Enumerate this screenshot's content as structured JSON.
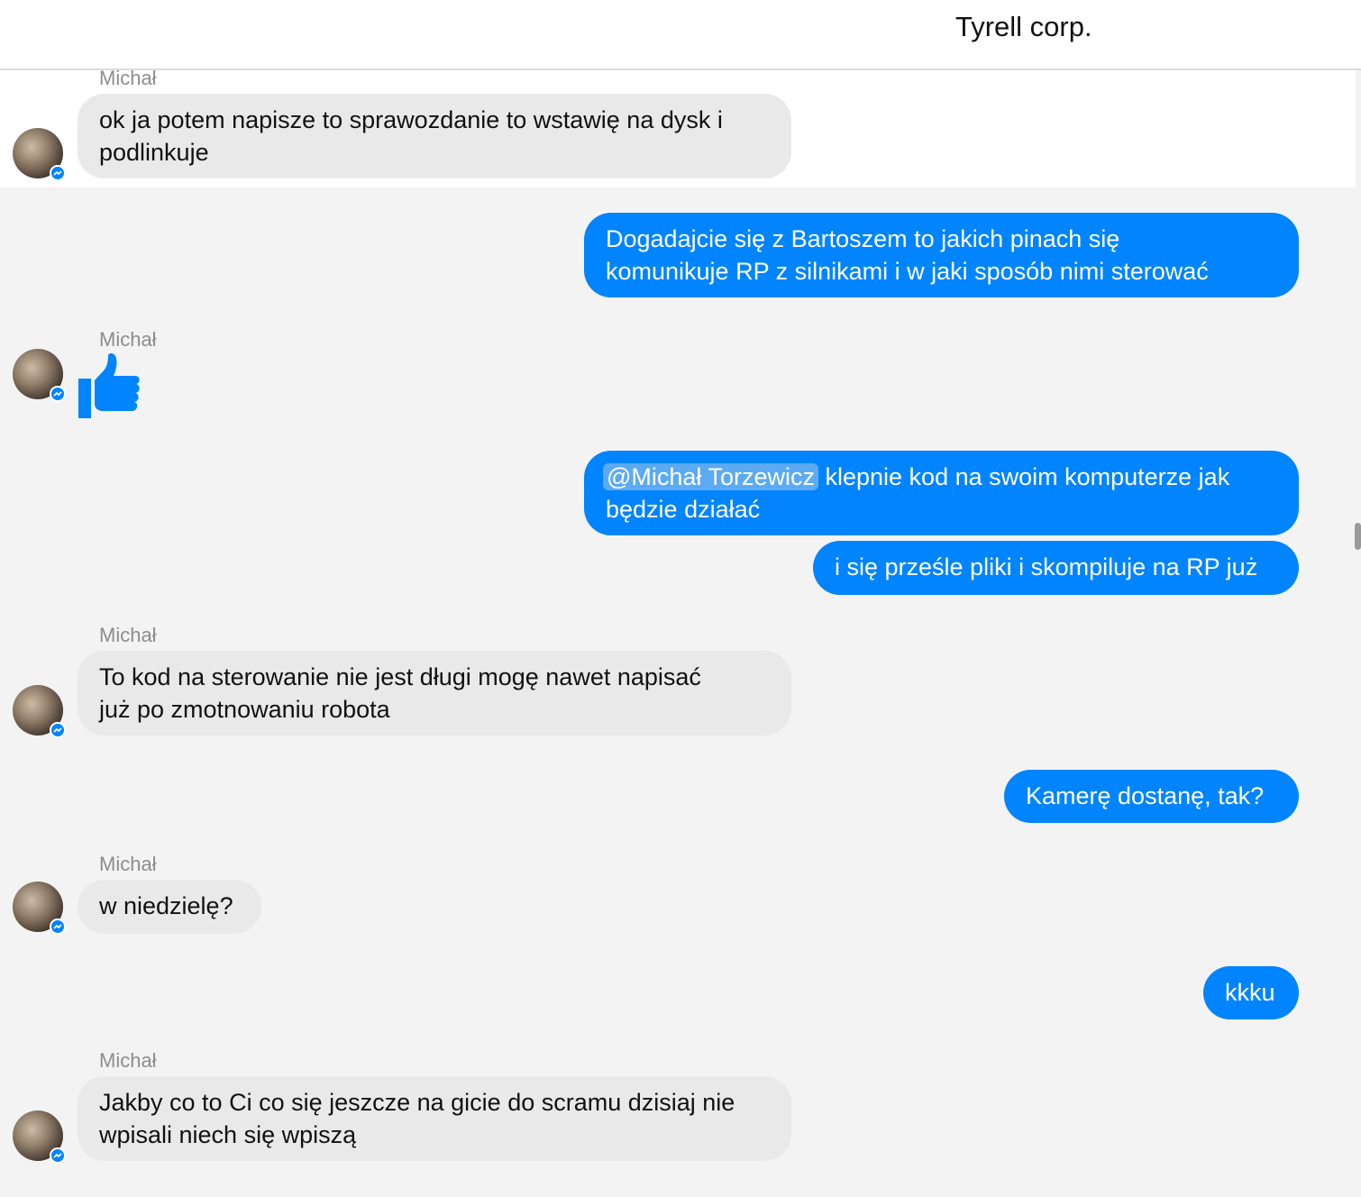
{
  "header": {
    "title": "Tyrell corp."
  },
  "messages": [
    {
      "sender": "Michał",
      "lines": [
        "ok ja potem napisze to sprawozdanie to wstawię na dysk i",
        "podlinkuje"
      ]
    },
    {
      "lines": [
        "Dogadajcie się z Bartoszem to jakich pinach się",
        "komunikuje RP z silnikami i w jaki sposób nimi sterować"
      ]
    },
    {
      "sender": "Michał",
      "sticker": "thumbs-up-icon"
    },
    {
      "mention": "@Michał Torzewicz",
      "lines": [
        "klepnie kod na swoim komputerze jak",
        "będzie działać"
      ]
    },
    {
      "lines": [
        "i się prześle pliki i skompiluje na RP już"
      ]
    },
    {
      "sender": "Michał",
      "lines": [
        "To kod na sterowanie nie jest  długi mogę nawet napisać",
        "już po zmotnowaniu robota"
      ]
    },
    {
      "lines": [
        "Kamerę dostanę, tak?"
      ]
    },
    {
      "sender": "Michał",
      "lines": [
        "w niedzielę?"
      ]
    },
    {
      "lines": [
        "kkku"
      ]
    },
    {
      "sender": "Michał",
      "lines": [
        "Jakby co to Ci co się jeszcze na gicie do scramu dzisiaj nie",
        "wpisali niech się wpiszą"
      ]
    }
  ],
  "colors": {
    "outgoing": "#0084ff",
    "incoming": "#e9e9e9",
    "background": "#f3f3f3"
  }
}
